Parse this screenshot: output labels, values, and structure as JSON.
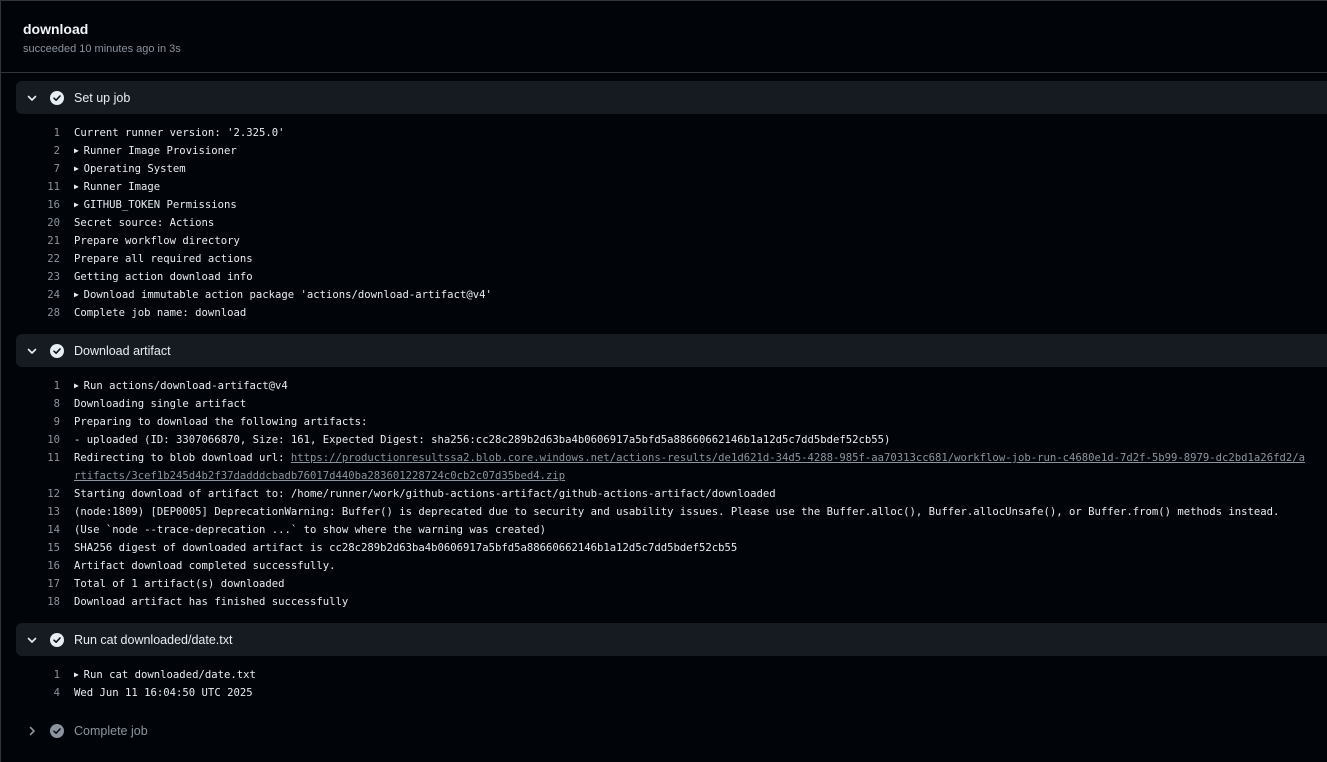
{
  "job": {
    "title": "download",
    "subtitle": "succeeded 10 minutes ago in 3s"
  },
  "steps": [
    {
      "name": "Set up job",
      "lines": [
        {
          "n": "1",
          "t": "Current runner version: '2.325.0'"
        },
        {
          "n": "2",
          "t": "Runner Image Provisioner",
          "group": true
        },
        {
          "n": "7",
          "t": "Operating System",
          "group": true
        },
        {
          "n": "11",
          "t": "Runner Image",
          "group": true
        },
        {
          "n": "16",
          "t": "GITHUB_TOKEN Permissions",
          "group": true
        },
        {
          "n": "20",
          "t": "Secret source: Actions"
        },
        {
          "n": "21",
          "t": "Prepare workflow directory"
        },
        {
          "n": "22",
          "t": "Prepare all required actions"
        },
        {
          "n": "23",
          "t": "Getting action download info"
        },
        {
          "n": "24",
          "t": "Download immutable action package 'actions/download-artifact@v4'",
          "group": true
        },
        {
          "n": "28",
          "t": "Complete job name: download"
        }
      ]
    },
    {
      "name": "Download artifact",
      "lines": [
        {
          "n": "1",
          "t": "Run actions/download-artifact@v4",
          "group": true
        },
        {
          "n": "8",
          "t": "Downloading single artifact"
        },
        {
          "n": "9",
          "t": "Preparing to download the following artifacts:"
        },
        {
          "n": "10",
          "t": "- uploaded (ID: 3307066870, Size: 161, Expected Digest: sha256:cc28c289b2d63ba4b0606917a5bfd5a88660662146b1a12d5c7dd5bdef52cb55)"
        },
        {
          "n": "11",
          "t": "Redirecting to blob download url: ",
          "url": "https://productionresultssa2.blob.core.windows.net/actions-results/de1d621d-34d5-4288-985f-aa70313cc681/workflow-job-run-c4680e1d-7d2f-5b99-8979-dc2bd1a26fd2/artifacts/3cef1b245d4b2f37dadddcbadb76017d440ba283601228724c0cb2c07d35bed4.zip"
        },
        {
          "n": "12",
          "t": "Starting download of artifact to: /home/runner/work/github-actions-artifact/github-actions-artifact/downloaded"
        },
        {
          "n": "13",
          "t": "(node:1809) [DEP0005] DeprecationWarning: Buffer() is deprecated due to security and usability issues. Please use the Buffer.alloc(), Buffer.allocUnsafe(), or Buffer.from() methods instead."
        },
        {
          "n": "14",
          "t": "(Use `node --trace-deprecation ...` to show where the warning was created)"
        },
        {
          "n": "15",
          "t": "SHA256 digest of downloaded artifact is cc28c289b2d63ba4b0606917a5bfd5a88660662146b1a12d5c7dd5bdef52cb55"
        },
        {
          "n": "16",
          "t": "Artifact download completed successfully."
        },
        {
          "n": "17",
          "t": "Total of 1 artifact(s) downloaded"
        },
        {
          "n": "18",
          "t": "Download artifact has finished successfully"
        }
      ]
    },
    {
      "name": "Run cat downloaded/date.txt",
      "lines": [
        {
          "n": "1",
          "t": "Run cat downloaded/date.txt",
          "group": true
        },
        {
          "n": "4",
          "t": "Wed Jun 11 16:04:50 UTC 2025"
        }
      ]
    }
  ],
  "collapsed_step": {
    "name": "Complete job"
  },
  "icons": {
    "expanded": "chevron-down-icon",
    "collapsed": "chevron-right-icon",
    "status": "check-circle-icon",
    "group": "triangle-right-icon"
  },
  "colors": {
    "success_check": "#e6edf3",
    "muted": "#8b949e",
    "step_header_bg": "#161b22"
  }
}
